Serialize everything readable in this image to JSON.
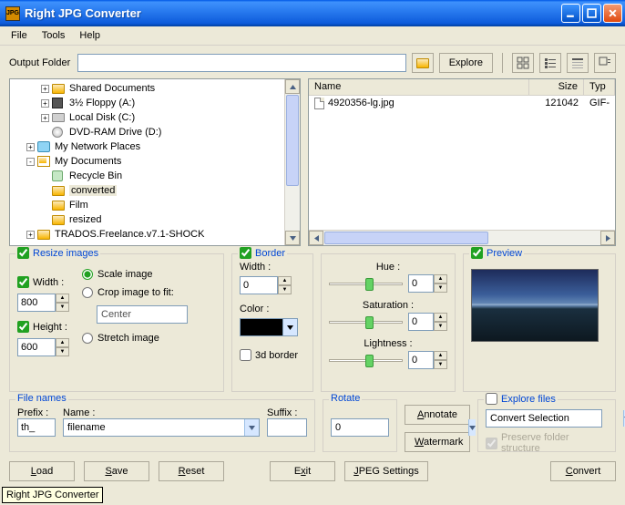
{
  "window": {
    "title": "Right JPG Converter"
  },
  "menu": {
    "file": "File",
    "tools": "Tools",
    "help": "Help"
  },
  "top": {
    "outputFolderLabel": "Output Folder",
    "outputFolderValue": "",
    "explore": "Explore"
  },
  "tree": {
    "items": [
      {
        "indent": 2,
        "pm": "+",
        "icon": "folder",
        "label": "Shared Documents"
      },
      {
        "indent": 2,
        "pm": "+",
        "icon": "floppy",
        "label": "3½ Floppy (A:)"
      },
      {
        "indent": 2,
        "pm": "+",
        "icon": "drive",
        "label": "Local Disk (C:)"
      },
      {
        "indent": 2,
        "pm": "",
        "icon": "dvd",
        "label": "DVD-RAM Drive (D:)"
      },
      {
        "indent": 1,
        "pm": "+",
        "icon": "net",
        "label": "My Network Places"
      },
      {
        "indent": 1,
        "pm": "-",
        "icon": "doc",
        "label": "My Documents"
      },
      {
        "indent": 2,
        "pm": "",
        "icon": "recy",
        "label": "Recycle Bin"
      },
      {
        "indent": 2,
        "pm": "",
        "icon": "folder",
        "label": "converted",
        "selected": true
      },
      {
        "indent": 2,
        "pm": "",
        "icon": "folder",
        "label": "Film"
      },
      {
        "indent": 2,
        "pm": "",
        "icon": "folder",
        "label": "resized"
      },
      {
        "indent": 1,
        "pm": "+",
        "icon": "folder",
        "label": "TRADOS.Freelance.v7.1-SHOCK"
      }
    ]
  },
  "list": {
    "cols": {
      "name": "Name",
      "size": "Size",
      "type": "Typ"
    },
    "rows": [
      {
        "name": "4920356-lg.jpg",
        "size": "121042",
        "type": "GIF-"
      }
    ]
  },
  "resize": {
    "title": "Resize images",
    "widthLabel": "Width :",
    "widthVal": "800",
    "heightLabel": "Height :",
    "heightVal": "600",
    "scale": "Scale image",
    "crop": "Crop image to fit:",
    "center": "Center",
    "stretch": "Stretch image"
  },
  "border": {
    "title": "Border",
    "widthLabel": "Width :",
    "widthVal": "0",
    "colorLabel": "Color :",
    "threeDLabel": "3d border",
    "colorHex": "#000000"
  },
  "color": {
    "hue": "Hue :",
    "hueVal": "0",
    "sat": "Saturation :",
    "satVal": "0",
    "light": "Lightness :",
    "lightVal": "0"
  },
  "preview": {
    "title": "Preview"
  },
  "filenames": {
    "title": "File names",
    "prefixLabel": "Prefix :",
    "prefixVal": "th_",
    "nameLabel": "Name :",
    "nameVal": "filename",
    "suffixLabel": "Suffix :",
    "suffixVal": ""
  },
  "rotate": {
    "title": "Rotate",
    "val": "0"
  },
  "buttons": {
    "annotate": "Annotate",
    "watermark": "Watermark"
  },
  "explore": {
    "title": "Explore files",
    "convertSel": "Convert Selection",
    "preserve": "Preserve folder structure"
  },
  "footer": {
    "load": "Load",
    "save": "Save",
    "reset": "Reset",
    "exit": "Exit",
    "jpeg": "JPEG Settings",
    "convert": "Convert"
  },
  "tooltip": "Right JPG Converter"
}
